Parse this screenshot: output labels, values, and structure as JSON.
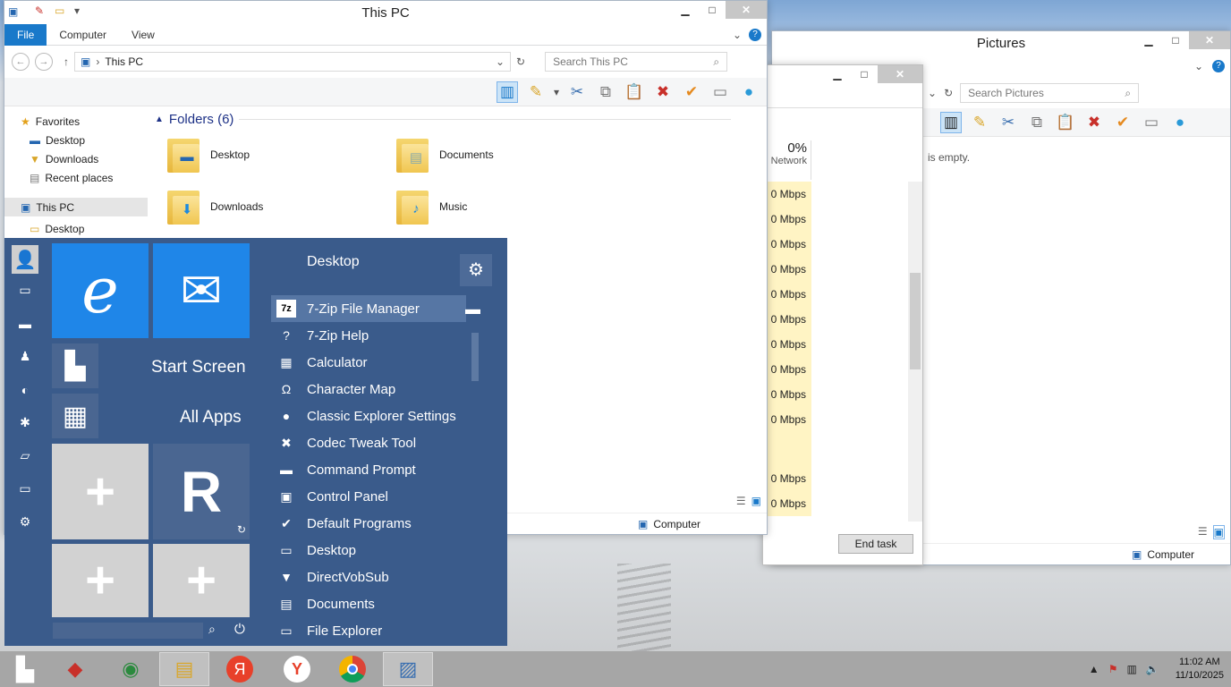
{
  "thispc": {
    "title": "This PC",
    "tabs": [
      "File",
      "Computer",
      "View"
    ],
    "address": "This PC",
    "search_placeholder": "Search This PC",
    "nav": {
      "favorites": "Favorites",
      "desktop": "Desktop",
      "downloads": "Downloads",
      "recent": "Recent places",
      "thispc": "This PC",
      "desktop2": "Desktop"
    },
    "folders_header": "Folders (6)",
    "folders": [
      "Desktop",
      "Documents",
      "Downloads",
      "Music"
    ],
    "status_computer": "Computer"
  },
  "pictures": {
    "title": "Pictures",
    "search_placeholder": "Search Pictures",
    "empty_text": "is empty.",
    "status_computer": "Computer"
  },
  "taskmgr": {
    "net_pct": "0%",
    "net_label": "Network",
    "rows": [
      "0 Mbps",
      "0 Mbps",
      "0 Mbps",
      "0 Mbps",
      "0 Mbps",
      "0 Mbps",
      "0 Mbps",
      "0 Mbps",
      "0 Mbps",
      "0 Mbps",
      "",
      "0 Mbps",
      "0 Mbps"
    ],
    "end_task": "End task"
  },
  "startmenu": {
    "header": "Desktop",
    "start_screen": "Start Screen",
    "all_apps": "All Apps",
    "apps": [
      {
        "label": "7-Zip File Manager",
        "icon": "7z"
      },
      {
        "label": "7-Zip Help",
        "icon": "?"
      },
      {
        "label": "Calculator",
        "icon": "▦"
      },
      {
        "label": "Character Map",
        "icon": "Ω"
      },
      {
        "label": "Classic Explorer Settings",
        "icon": "●"
      },
      {
        "label": "Codec Tweak Tool",
        "icon": "✖"
      },
      {
        "label": "Command Prompt",
        "icon": "▬"
      },
      {
        "label": "Control Panel",
        "icon": "▣"
      },
      {
        "label": "Default Programs",
        "icon": "✔"
      },
      {
        "label": "Desktop",
        "icon": "▭"
      },
      {
        "label": "DirectVobSub",
        "icon": "▼"
      },
      {
        "label": "Documents",
        "icon": "▤"
      },
      {
        "label": "File Explorer",
        "icon": "▭"
      }
    ]
  },
  "taskbar": {
    "time": "11:02 AM",
    "date": "11/10/2025"
  }
}
